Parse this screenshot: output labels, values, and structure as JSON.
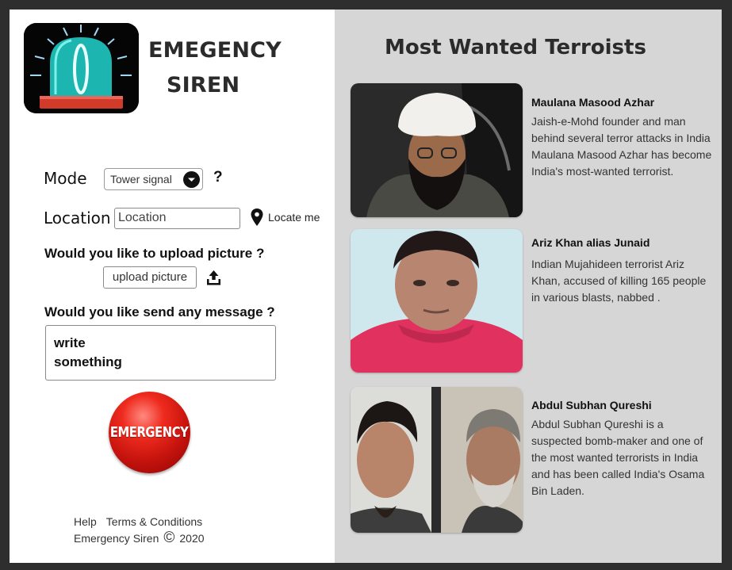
{
  "app": {
    "title_line1": "EMEGENCY",
    "title_line2": "SIREN",
    "logo_icon": "siren-icon"
  },
  "form": {
    "mode_label": "Mode",
    "mode_value": "Tower signal",
    "mode_help": "?",
    "location_label": "Location",
    "location_placeholder": "Location",
    "locate_me_label": "Locate me",
    "upload_question": "Would you like to upload picture ?",
    "upload_button_label": "upload picture",
    "message_question": "Would you like send any message ?",
    "message_line1": "write",
    "message_line2": "something",
    "emergency_label": "EMERGENCY",
    "accent_red": "#d81b12"
  },
  "footer": {
    "help": "Help",
    "terms": "Terms & Conditions",
    "brand": "Emergency Siren",
    "copyright_symbol": "©",
    "year": "2020"
  },
  "wanted": {
    "title": "Most Wanted Terroists",
    "items": [
      {
        "name": "Maulana Masood Azhar",
        "description": "Jaish-e-Mohd founder and man behind several terror attacks in India Maulana Masood Azhar has become India's most-wanted terrorist."
      },
      {
        "name": "Ariz Khan alias Junaid",
        "description": "Indian Mujahideen terrorist Ariz Khan, accused of killing 165 people in various blasts, nabbed ."
      },
      {
        "name": "Abdul Subhan Qureshi",
        "description": "Abdul Subhan Qureshi is a suspected bomb-maker and one of the most wanted terrorists in India and has been called India's Osama Bin Laden."
      }
    ]
  }
}
